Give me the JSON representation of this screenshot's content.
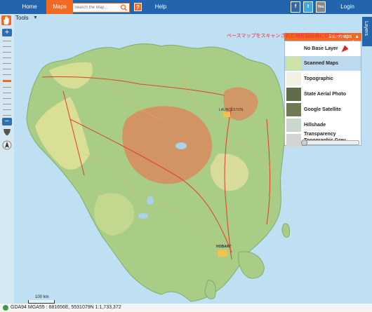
{
  "nav": {
    "home": "Home",
    "maps": "Maps",
    "help": "Help",
    "login": "Login",
    "search_placeholder": "Search the Map...",
    "help_icon_text": "?"
  },
  "social": {
    "facebook": "f",
    "twitter": "t",
    "youtube": "You Tube"
  },
  "tools": {
    "label": "Tools"
  },
  "layers_tab": {
    "label": "Layers"
  },
  "basemaps": {
    "header": "Basemaps",
    "no_base": "No Base Layer",
    "items": [
      {
        "label": "Scanned Maps",
        "selected": true,
        "thumb_color": "#cfe3a8"
      },
      {
        "label": "Topographic",
        "selected": false,
        "thumb_color": "#f3efe2"
      },
      {
        "label": "State Aerial Photo",
        "selected": false,
        "thumb_color": "#5f6d4a"
      },
      {
        "label": "Google Satellite",
        "selected": false,
        "thumb_color": "#6f7a55"
      },
      {
        "label": "Hillshade",
        "selected": false,
        "thumb_color": "#c9d7cf"
      },
      {
        "label": "Topographic Grey",
        "selected": false,
        "thumb_color": "#d4d4d4"
      }
    ],
    "transparency": "Transparency",
    "transparency_value": 0
  },
  "annotation": "ベースマップをスキャンされた地形図画像に切り替え",
  "map_labels": {
    "launceston": "LAUNCESTON",
    "hobart": "HOBART"
  },
  "scale": {
    "label": "100 km"
  },
  "status": {
    "text": "GDA94 MGA55 : 681656E, 5531079N 1:1,733,372"
  },
  "colors": {
    "nav_bg": "#2365ad",
    "accent": "#f06a24",
    "sea": "#bfe0f2",
    "land": "#a9cc86"
  }
}
